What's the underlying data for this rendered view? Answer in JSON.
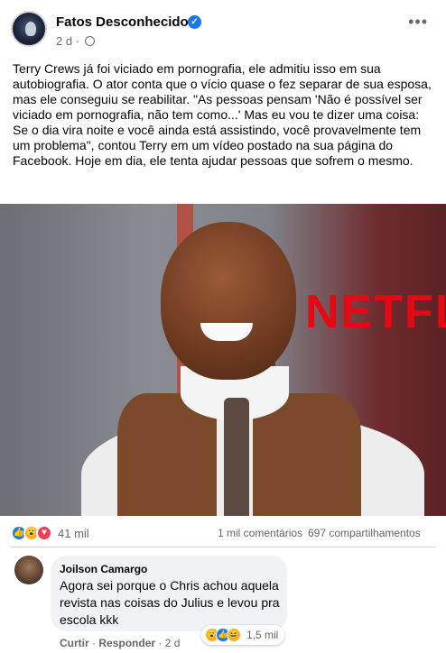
{
  "post": {
    "page_name": "Fatos Desconhecidos",
    "time": "2 d",
    "body": "Terry Crews já foi viciado em pornografia, ele admitiu isso em sua autobiografia. O ator conta que o vício quase o fez separar de sua esposa, mas ele conseguiu se reabilitar. \"As pessoas pensam 'Não é possível ser viciado em pornografia, não tem como...' Mas eu vou te dizer uma coisa: Se o dia vira noite e você ainda está assistindo, você provavelmente tem um problema\", contou Terry em um vídeo postado na sua página do Facebook. Hoje em dia, ele tenta ajudar pessoas que sofrem o mesmo.",
    "photo_text": "NETFLIX",
    "reactions_count": "41 mil",
    "comments_count": "1 mil comentários",
    "shares_count": "697 compartilhamentos",
    "icons": {
      "verified": "verified-badge-icon",
      "privacy": "globe-icon",
      "more": "more-options-icon"
    }
  },
  "comment": {
    "author": "Joilson Camargo",
    "text": "Agora sei porque o Chris achou aquela revista nas coisas do Julius e levou pra escola kkk",
    "reactions_count": "1,5 mil",
    "like_label": "Curtir",
    "reply_label": "Responder",
    "time": "2 d"
  },
  "colors": {
    "accent": "#1877f2",
    "secondary_text": "#65676b",
    "netflix_red": "#e50914"
  }
}
